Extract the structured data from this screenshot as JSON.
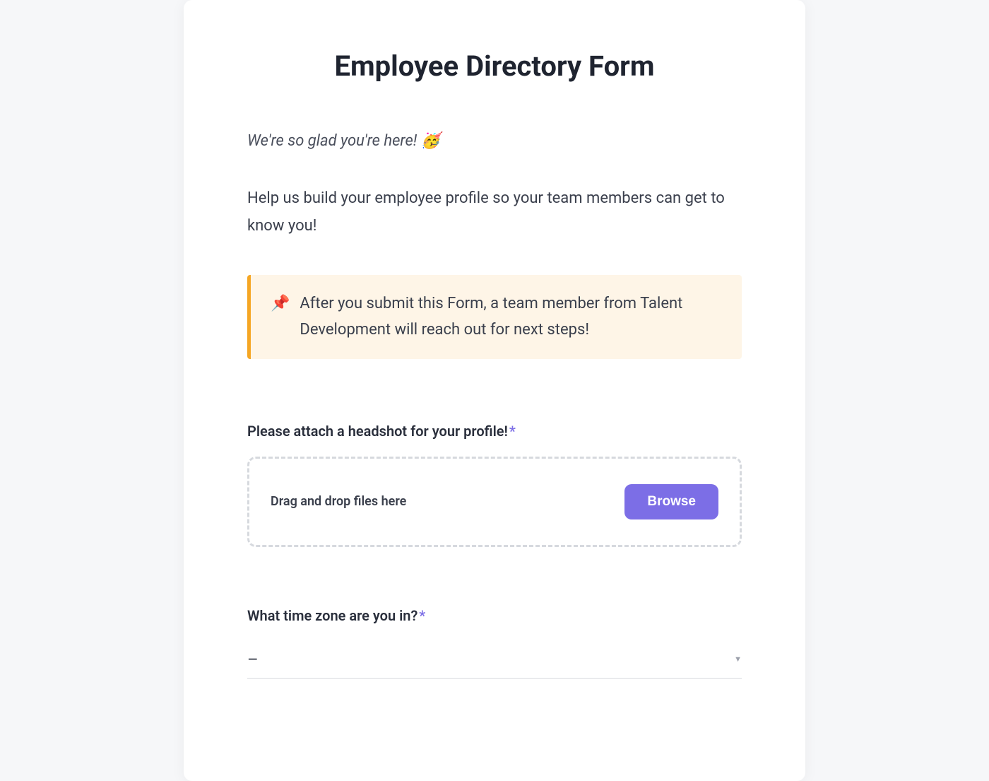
{
  "title": "Employee Directory Form",
  "intro": {
    "greeting": "We're so glad you're here! 🥳",
    "help": "Help us build your employee profile so your team members can get to know you!"
  },
  "callout": {
    "icon": "📌",
    "text": "After you submit this Form, a team member from Talent Development will reach out for next steps!"
  },
  "fields": {
    "headshot": {
      "label": "Please attach a headshot for your profile!",
      "required_marker": "*",
      "dropzone_text": "Drag and drop files here",
      "browse_label": "Browse"
    },
    "timezone": {
      "label": "What time zone are you in?",
      "required_marker": "*",
      "selected": "–"
    }
  }
}
